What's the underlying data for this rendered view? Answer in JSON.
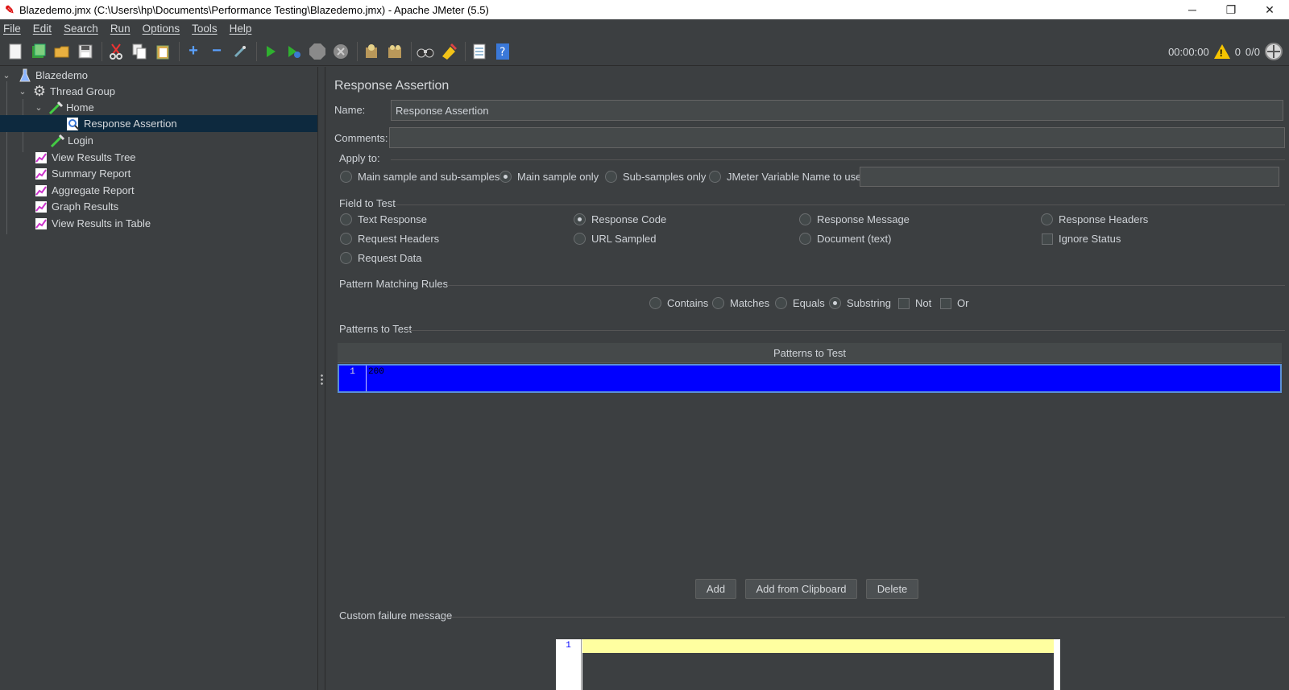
{
  "window": {
    "title": "Blazedemo.jmx (C:\\Users\\hp\\Documents\\Performance Testing\\Blazedemo.jmx) - Apache JMeter (5.5)",
    "minimize": "─",
    "restore": "❐",
    "close": "✕"
  },
  "menu": [
    "File",
    "Edit",
    "Search",
    "Run",
    "Options",
    "Tools",
    "Help"
  ],
  "toolbar": {
    "timer": "00:00:00",
    "warnings": "0",
    "threads": "0/0"
  },
  "tree": {
    "root": "Blazedemo",
    "thread_group": "Thread Group",
    "home": "Home",
    "response_assertion": "Response Assertion",
    "login": "Login",
    "view_results_tree": "View Results Tree",
    "summary_report": "Summary Report",
    "aggregate_report": "Aggregate Report",
    "graph_results": "Graph Results",
    "view_results_table": "View Results in Table"
  },
  "panel": {
    "heading": "Response Assertion",
    "name_label": "Name:",
    "name_value": "Response Assertion",
    "comments_label": "Comments:",
    "comments_value": "",
    "apply_to": {
      "title": "Apply to:",
      "main_and_sub": "Main sample and sub-samples",
      "main_only": "Main sample only",
      "sub_only": "Sub-samples only",
      "jmeter_var": "JMeter Variable Name to use",
      "jmeter_var_value": "",
      "selected": "main_only"
    },
    "field_to_test": {
      "title": "Field to Test",
      "text_response": "Text Response",
      "response_code": "Response Code",
      "response_message": "Response Message",
      "response_headers": "Response Headers",
      "request_headers": "Request Headers",
      "url_sampled": "URL Sampled",
      "document_text": "Document (text)",
      "ignore_status": "Ignore Status",
      "request_data": "Request Data",
      "selected": "response_code",
      "ignore_status_checked": false
    },
    "pattern_rules": {
      "title": "Pattern Matching Rules",
      "contains": "Contains",
      "matches": "Matches",
      "equals": "Equals",
      "substring": "Substring",
      "not": "Not",
      "or": "Or",
      "selected": "substring",
      "not_checked": false,
      "or_checked": false
    },
    "patterns": {
      "title": "Patterns to Test",
      "column": "Patterns to Test",
      "rows": [
        {
          "num": "1",
          "value": "200"
        }
      ],
      "add": "Add",
      "add_clipboard": "Add from Clipboard",
      "delete": "Delete"
    },
    "failure": {
      "title": "Custom failure message",
      "line_number": "1"
    }
  }
}
